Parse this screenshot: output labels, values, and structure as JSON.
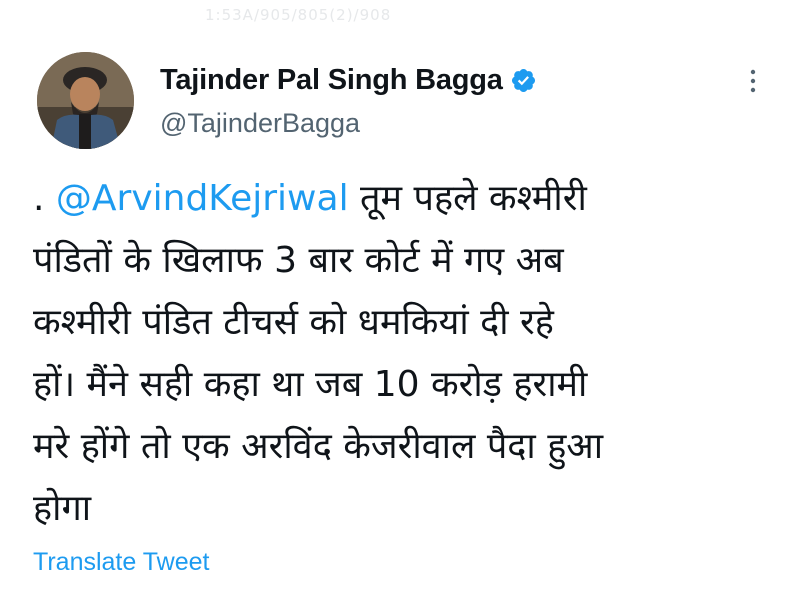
{
  "watermark": "1:53A/905/805(2)/908",
  "author": {
    "name": "Tajinder Pal Singh Bagga",
    "handle": "@TajinderBagga",
    "verified": true
  },
  "tweet": {
    "lead": ". ",
    "mention": "@ArvindKejriwal",
    "line1_rest": " तूम पहले कश्मीरी",
    "line2": "पंडितों के खिलाफ 3 बार कोर्ट में गए अब",
    "line3": "कश्मीरी पंडित टीचर्स को धमकियां दी रहे",
    "line4": "हों। मैंने सही कहा था जब 10 करोड़ हरामी",
    "line5": "मरे होंगे तो एक अरविंद केजरीवाल पैदा हुआ",
    "line6": "होगा"
  },
  "translate_label": "Translate Tweet",
  "icons": {
    "verified": "verified-badge-icon",
    "more": "more-options-icon"
  },
  "colors": {
    "accent": "#1d9bf0",
    "text": "#0f1419",
    "secondary": "#536471"
  }
}
